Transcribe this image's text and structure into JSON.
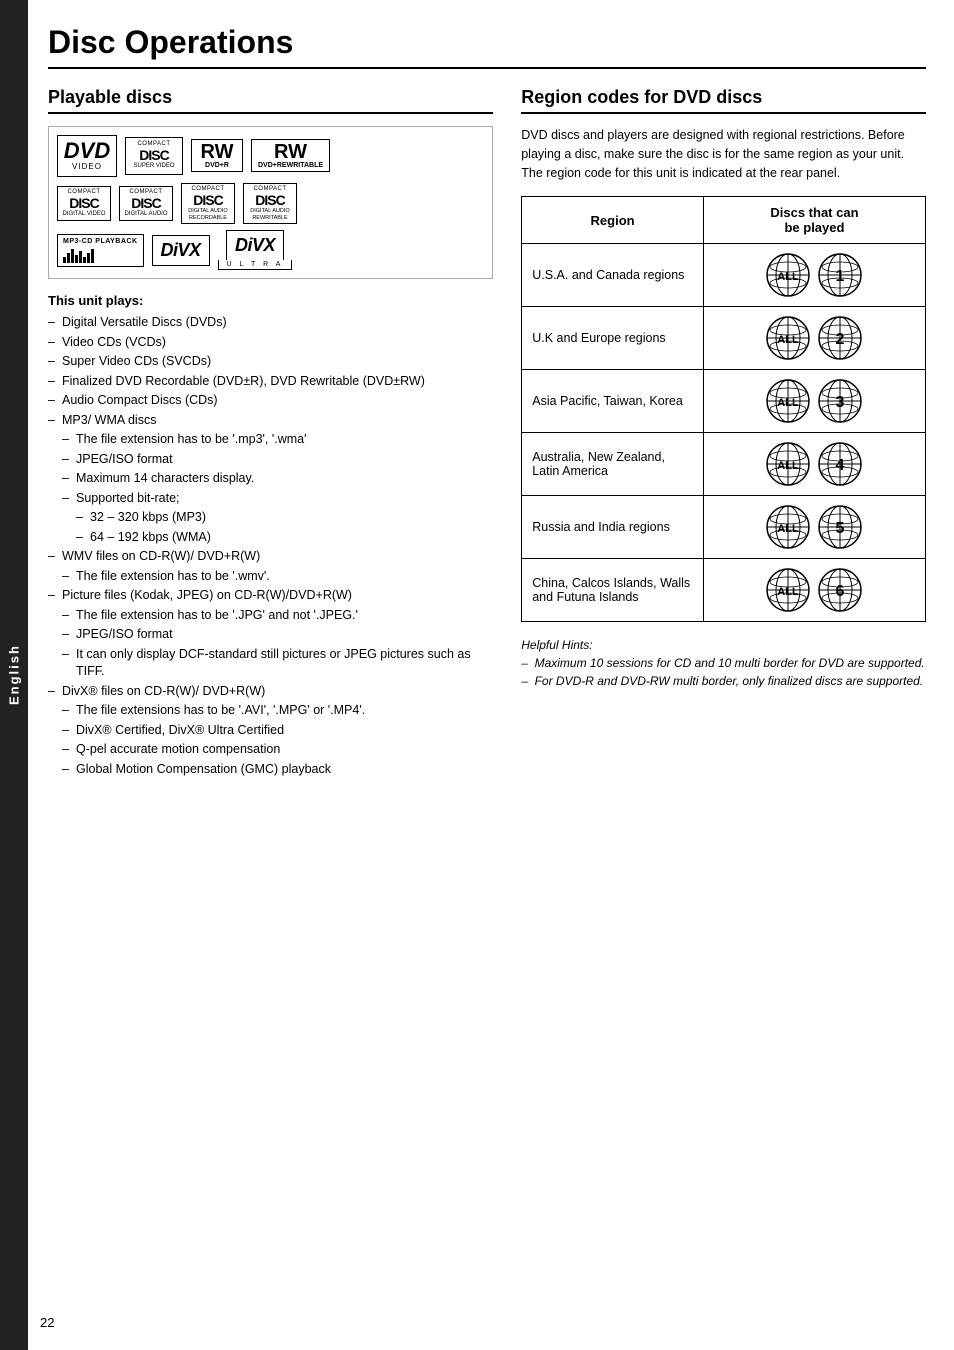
{
  "page": {
    "title": "Disc Operations",
    "page_number": "22",
    "side_tab": "English"
  },
  "left_section": {
    "title": "Playable discs",
    "this_unit_plays_label": "This unit plays:",
    "play_items": [
      {
        "text": "Digital Versatile Discs (DVDs)",
        "level": 0
      },
      {
        "text": "Video CDs (VCDs)",
        "level": 0
      },
      {
        "text": "Super Video CDs (SVCDs)",
        "level": 0
      },
      {
        "text": "Finalized DVD Recordable (DVD±R), DVD Rewritable (DVD±RW)",
        "level": 0
      },
      {
        "text": "Audio Compact Discs (CDs)",
        "level": 0
      },
      {
        "text": "MP3/ WMA discs",
        "level": 0
      },
      {
        "text": "The file extension has to be '.mp3', '.wma'",
        "level": 1
      },
      {
        "text": "JPEG/ISO format",
        "level": 1
      },
      {
        "text": "Maximum 14 characters display.",
        "level": 1
      },
      {
        "text": "Supported bit-rate;",
        "level": 1
      },
      {
        "text": "32 – 320 kbps (MP3)",
        "level": 2
      },
      {
        "text": "64 – 192 kbps (WMA)",
        "level": 2
      },
      {
        "text": "WMV files on CD-R(W)/ DVD+R(W)",
        "level": 0
      },
      {
        "text": "The file extension has to be '.wmv'.",
        "level": 1
      },
      {
        "text": "Picture files (Kodak, JPEG) on CD-R(W)/DVD+R(W)",
        "level": 0
      },
      {
        "text": "The file extension has to be '.JPG' and not '.JPEG.'",
        "level": 1
      },
      {
        "text": "JPEG/ISO format",
        "level": 1
      },
      {
        "text": "It can only display DCF-standard still pictures or JPEG pictures such as TIFF.",
        "level": 1
      },
      {
        "text": "DivX® files on CD-R(W)/ DVD+R(W)",
        "level": 0
      },
      {
        "text": "The file extensions has to be '.AVI', '.MPG' or '.MP4'.",
        "level": 1
      },
      {
        "text": "DivX® Certified, DivX® Ultra Certified",
        "level": 1
      },
      {
        "text": "Q-pel accurate motion compensation",
        "level": 1
      },
      {
        "text": "Global Motion Compensation (GMC) playback",
        "level": 1
      }
    ]
  },
  "right_section": {
    "title": "Region codes for DVD discs",
    "description": "DVD discs and players are designed with regional restrictions. Before playing a disc, make sure the disc is for the same region as your unit. The region code for this unit is indicated at the rear panel.",
    "table_headers": [
      "Region",
      "Discs that can be played"
    ],
    "regions": [
      {
        "name": "U.S.A. and Canada regions",
        "number": "1"
      },
      {
        "name": "U.K and Europe regions",
        "number": "2"
      },
      {
        "name": "Asia Pacific, Taiwan, Korea",
        "number": "3"
      },
      {
        "name": "Australia, New Zealand, Latin America",
        "number": "4"
      },
      {
        "name": "Russia and India regions",
        "number": "5"
      },
      {
        "name": "China, Calcos Islands, Walls and Futuna Islands",
        "number": "6"
      }
    ],
    "helpful_hints_label": "Helpful Hints:",
    "hints": [
      "Maximum 10 sessions for CD and 10 multi border for DVD are supported.",
      "For DVD-R and DVD-RW multi border, only finalized discs are supported."
    ]
  },
  "disc_icons": {
    "row1": [
      "DVD VIDEO",
      "DVD SUPER VIDEO",
      "DVD+R",
      "DVD+ReWritable"
    ],
    "row2": [
      "CD DIGITAL VIDEO",
      "CD DIGITAL AUDIO",
      "CD DIGITAL AUDIO Recordable",
      "CD DIGITAL AUDIO ReWritable"
    ],
    "row3": [
      "MP3-CD PLAYBACK",
      "DivX",
      "DivX ULTRA"
    ]
  }
}
